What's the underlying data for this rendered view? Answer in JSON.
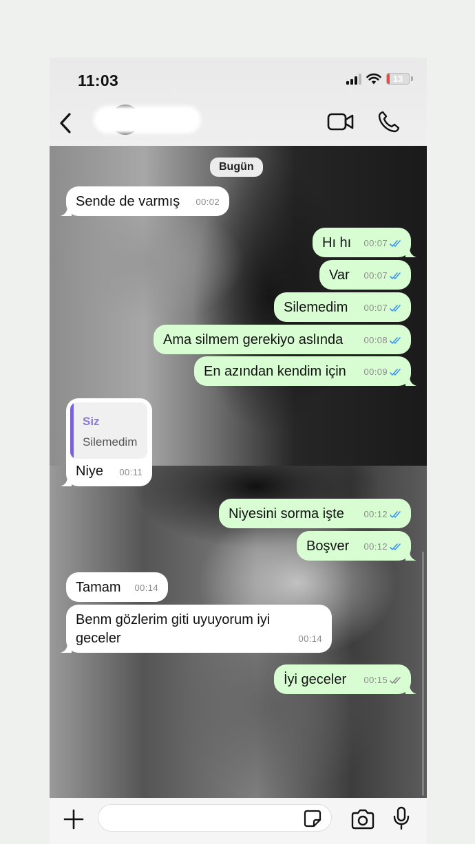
{
  "status_bar": {
    "time": "11:03",
    "battery": "13",
    "battery_level": 0.13
  },
  "header": {
    "back_icon": "chevron-left-icon",
    "video_icon": "video-camera-icon",
    "call_icon": "phone-icon"
  },
  "chat": {
    "date_label": "Bugün",
    "messages": [
      {
        "direction": "in",
        "text": "Sende de varmış",
        "time": "00:02"
      },
      {
        "direction": "out",
        "text": "Hı hı",
        "time": "00:07",
        "status": "read"
      },
      {
        "direction": "out",
        "text": "Var",
        "time": "00:07",
        "status": "read"
      },
      {
        "direction": "out",
        "text": "Silemedim",
        "time": "00:07",
        "status": "read"
      },
      {
        "direction": "out",
        "text": "Ama silmem gerekiyo aslında",
        "time": "00:08",
        "status": "read"
      },
      {
        "direction": "out",
        "text": "En azından kendim için",
        "time": "00:09",
        "status": "read"
      },
      {
        "direction": "in",
        "text": "Niye",
        "time": "00:11",
        "reply_to": {
          "author": "Siz",
          "text": "Silemedim"
        }
      },
      {
        "direction": "out",
        "text": "Niyesini sorma işte",
        "time": "00:12",
        "status": "read"
      },
      {
        "direction": "out",
        "text": "Boşver",
        "time": "00:12",
        "status": "read"
      },
      {
        "direction": "in",
        "text": "Tamam",
        "time": "00:14"
      },
      {
        "direction": "in",
        "text_lines": [
          "Benm gözlerim giti uyuyorum iyi",
          "geceler"
        ],
        "time": "00:14"
      },
      {
        "direction": "out",
        "text": "İyi geceler",
        "time": "00:15",
        "status": "delivered"
      }
    ]
  },
  "composer": {
    "plus_icon": "plus-icon",
    "sticker_icon": "sticker-icon",
    "camera_icon": "camera-icon",
    "mic_icon": "microphone-icon"
  },
  "colors": {
    "incoming_bubble": "#ffffff",
    "outgoing_bubble": "#d9fdd3",
    "read_tick": "#3b96f0",
    "delivered_tick": "#8a8a8a",
    "quote_accent": "#7b61d6"
  }
}
